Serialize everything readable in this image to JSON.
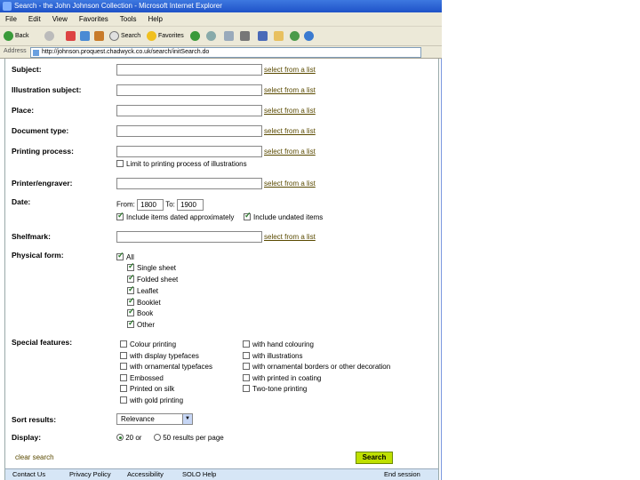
{
  "window": {
    "title": "Search - the John Johnson Collection - Microsoft Internet Explorer"
  },
  "menu": [
    "File",
    "Edit",
    "View",
    "Favorites",
    "Tools",
    "Help"
  ],
  "toolbar": {
    "back": "Back",
    "search": "Search",
    "favorites": "Favorites"
  },
  "address": {
    "label": "Address",
    "url": "http://johnson.proquest.chadwyck.co.uk/search/initSearch.do"
  },
  "form": {
    "subject": "Subject:",
    "illustration_subject": "Illustration subject:",
    "place": "Place:",
    "document_type": "Document type:",
    "printing_process": "Printing process:",
    "limit_illustrations": "Limit to printing process of illustrations",
    "printer_engraver": "Printer/engraver:",
    "date": "Date:",
    "from_label": "From:",
    "from_value": "1800",
    "to_label": "To:",
    "to_value": "1900",
    "include_approx": "Include items dated approximately",
    "include_undated": "Include undated items",
    "shelfmark": "Shelfmark:",
    "physical_form": "Physical form:",
    "physical_form_options": [
      "All",
      "Single sheet",
      "Folded sheet",
      "Leaflet",
      "Booklet",
      "Book",
      "Other"
    ],
    "special_features": "Special features:",
    "special_left": [
      "Colour printing",
      "with display typefaces",
      "with ornamental typefaces",
      "Embossed",
      "Printed on silk",
      "with gold printing"
    ],
    "special_right": [
      "with hand colouring",
      "with illustrations",
      "with ornamental borders or other decoration",
      "with printed in coating",
      "Two-tone printing"
    ],
    "sort_results": "Sort results:",
    "sort_value": "Relevance",
    "display": "Display:",
    "display_20": "20 or",
    "display_50": "50 results per page",
    "select_from_list": "select from a list",
    "clear_search": "clear search",
    "search_button": "Search"
  },
  "footer": {
    "contact": "Contact Us",
    "privacy": "Privacy Policy",
    "accessibility": "Accessibility",
    "help": "SOLO Help",
    "end_session": "End session"
  }
}
